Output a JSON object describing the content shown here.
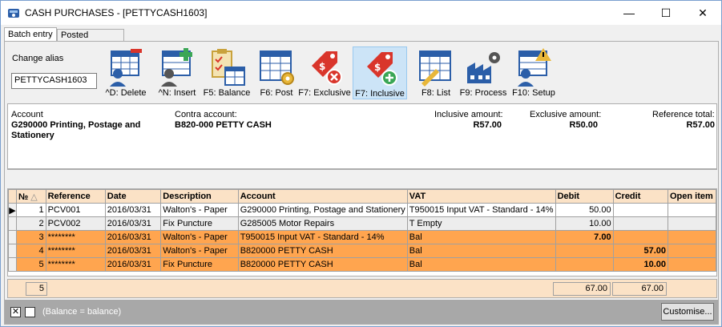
{
  "window": {
    "title": "CASH PURCHASES - [PETTYCASH1603]",
    "controls": {
      "minimize": "—",
      "maximize": "☐",
      "close": "✕"
    }
  },
  "tabs": [
    {
      "label": "Batch entry",
      "active": true
    },
    {
      "label": "Posted batches",
      "active": false
    }
  ],
  "alias": {
    "label": "Change alias",
    "value": "PETTYCASH1603"
  },
  "toolbar": [
    {
      "label": "^D: Delete",
      "icon": "delete-icon"
    },
    {
      "label": "^N: Insert",
      "icon": "insert-icon"
    },
    {
      "label": "F5: Balance",
      "icon": "balance-icon"
    },
    {
      "label": "F6: Post",
      "icon": "post-icon"
    },
    {
      "label": "F7: Exclusive",
      "icon": "exclusive-icon"
    },
    {
      "label": "F7: Inclusive",
      "icon": "inclusive-icon",
      "active": true
    },
    {
      "label": "F8: List",
      "icon": "list-icon"
    },
    {
      "label": "F9: Process",
      "icon": "process-icon"
    },
    {
      "label": "F10: Setup",
      "icon": "setup-icon"
    }
  ],
  "info": {
    "account_caption": "Account",
    "account_value": "G290000 Printing, Postage and Stationery",
    "contra_caption": "Contra account:",
    "contra_value": "B820-000 PETTY CASH",
    "inclusive_caption": "Inclusive amount:",
    "inclusive_value": "R57.00",
    "exclusive_caption": "Exclusive amount:",
    "exclusive_value": "R50.00",
    "reftotal_caption": "Reference total:",
    "reftotal_value": "R57.00"
  },
  "grid": {
    "columns": [
      "№",
      "Reference",
      "Date",
      "Description",
      "Account",
      "VAT",
      "Debit",
      "Credit",
      "Open item"
    ],
    "sort_indicator": "△",
    "rows": [
      {
        "no": "1",
        "reference": "PCV001",
        "date": "2016/03/31",
        "description": "Walton's - Paper",
        "account": "G290000 Printing, Postage and Stationery",
        "vat": "T950015 Input VAT - Standard - 14%",
        "debit": "50.00",
        "credit": "",
        "open_item": "",
        "style": "norm",
        "current": true
      },
      {
        "no": "2",
        "reference": "PCV002",
        "date": "2016/03/31",
        "description": "Fix Puncture",
        "account": "G285005 Motor Repairs",
        "vat": "T Empty",
        "debit": "10.00",
        "credit": "",
        "open_item": "",
        "style": "alt",
        "current": false
      },
      {
        "no": "3",
        "reference": "********",
        "date": "2016/03/31",
        "description": "Walton's - Paper",
        "account": "T950015 Input VAT - Standard - 14%",
        "vat": "Bal",
        "debit": "7.00",
        "credit": "",
        "open_item": "",
        "style": "hl",
        "current": false
      },
      {
        "no": "4",
        "reference": "********",
        "date": "2016/03/31",
        "description": "Walton's - Paper",
        "account": "B820000 PETTY CASH",
        "vat": "Bal",
        "debit": "",
        "credit": "57.00",
        "open_item": "",
        "style": "hl",
        "current": false
      },
      {
        "no": "5",
        "reference": "********",
        "date": "2016/03/31",
        "description": "Fix Puncture",
        "account": "B820000 PETTY CASH",
        "vat": "Bal",
        "debit": "",
        "credit": "10.00",
        "open_item": "",
        "style": "hl",
        "current": false
      }
    ]
  },
  "footer": {
    "count": "5",
    "debit_total": "67.00",
    "credit_total": "67.00"
  },
  "status": {
    "checkbox1": "✕",
    "checkbox2": "",
    "text": "(Balance = balance)",
    "customise_label": "Customise..."
  }
}
